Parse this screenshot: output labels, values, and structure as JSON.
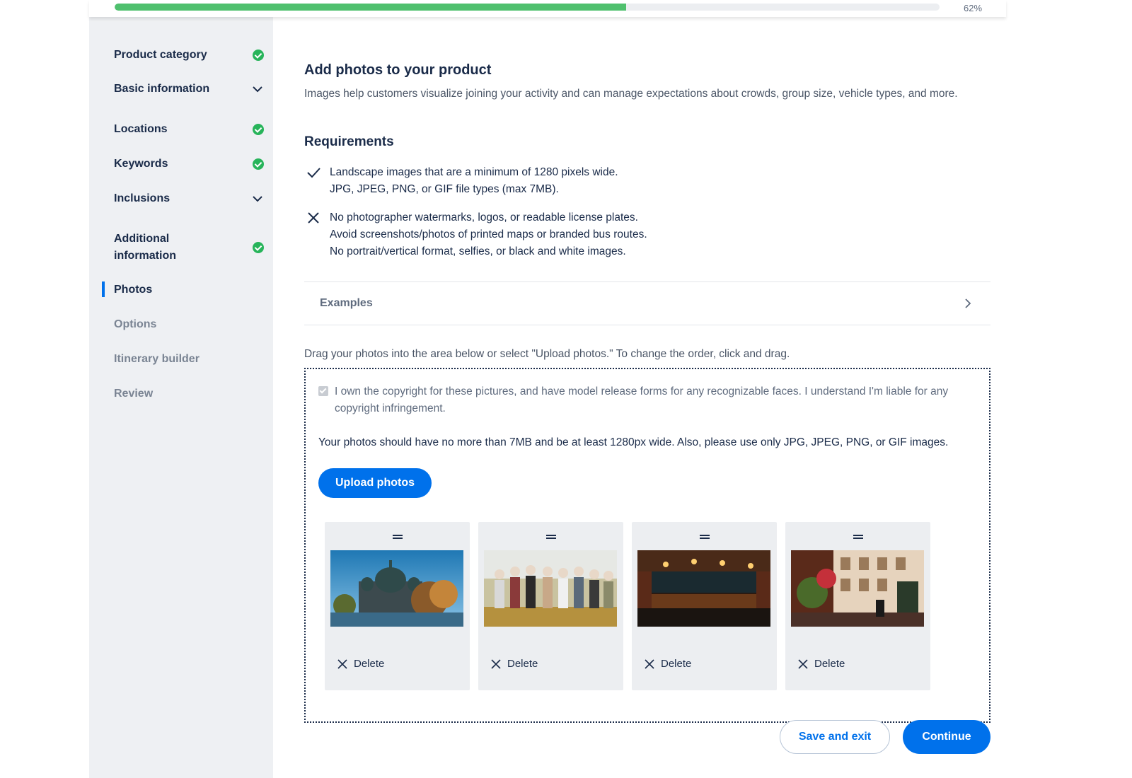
{
  "progress": {
    "value": 0.62,
    "label": "62%",
    "color": "#4fc06e"
  },
  "sidebar": {
    "items": [
      {
        "label": "Product category",
        "state": "complete"
      },
      {
        "label": "Basic information",
        "state": "expandable"
      },
      {
        "label": "Locations",
        "state": "complete"
      },
      {
        "label": "Keywords",
        "state": "complete"
      },
      {
        "label": "Inclusions",
        "state": "expandable"
      },
      {
        "label": "Additional information",
        "state": "complete"
      },
      {
        "label": "Photos",
        "state": "active"
      },
      {
        "label": "Options",
        "state": "pending"
      },
      {
        "label": "Itinerary builder",
        "state": "pending"
      },
      {
        "label": "Review",
        "state": "pending"
      }
    ]
  },
  "main": {
    "title": "Add photos to your product",
    "lead": "Images help customers visualize joining your activity and can manage expectations about crowds, group size, vehicle types, and more.",
    "requirements_title": "Requirements",
    "allowed": {
      "icon": "checkmark-icon",
      "lines": [
        "Landscape images that are a minimum of 1280 pixels wide.",
        "JPG, JPEG, PNG, or GIF file types (max 7MB)."
      ]
    },
    "disallowed": {
      "icon": "x-icon",
      "lines": [
        "No photographer watermarks, logos, or readable license plates.",
        "Avoid screenshots/photos of printed maps or branded bus routes.",
        "No portrait/vertical format, selfies, or black and white images."
      ]
    },
    "examples_label": "Examples",
    "drag_hint": "Drag your photos into the area below or select \"Upload photos.\" To change the order, click and drag.",
    "dropzone": {
      "consent": "I own the copyright for these pictures, and have model release forms for any recognizable faces. I understand I'm liable for any copyright infringement.",
      "note": "Your photos should have no more than 7MB and be at least 1280px wide. Also, please use only JPG, JPEG, PNG, or GIF images.",
      "upload_label": "Upload photos",
      "photos": [
        {
          "delete_label": "Delete"
        },
        {
          "delete_label": "Delete"
        },
        {
          "delete_label": "Delete"
        },
        {
          "delete_label": "Delete"
        }
      ]
    },
    "footer": {
      "save_label": "Save and exit",
      "continue_label": "Continue"
    }
  },
  "colors": {
    "accent": "#0071eb",
    "success": "#27b45a",
    "text": "#1a2b49"
  }
}
